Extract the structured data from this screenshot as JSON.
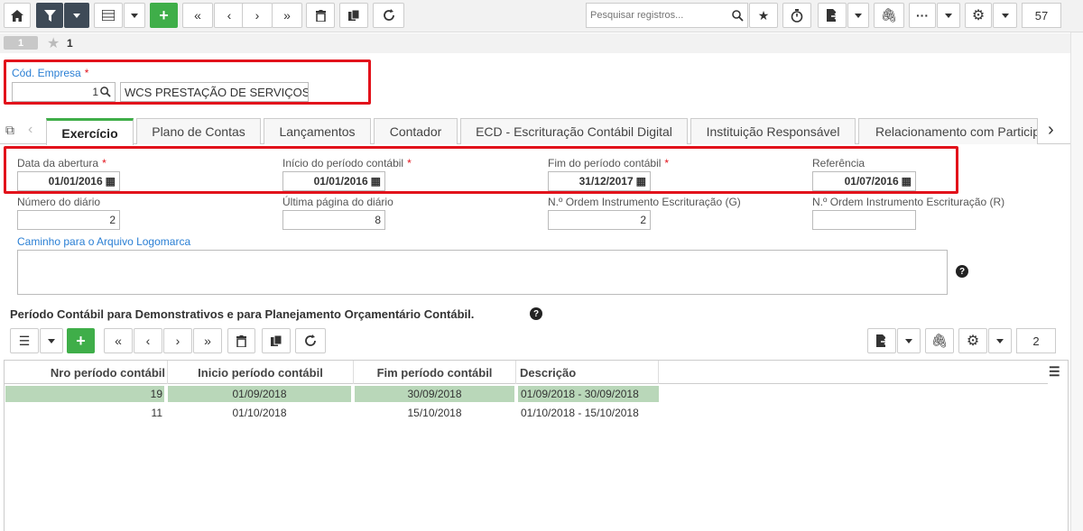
{
  "toolbar": {
    "home": "home-icon",
    "filter": "filter-icon",
    "list": "list-icon",
    "add": "+",
    "search_placeholder": "Pesquisar registros...",
    "record_count": "57"
  },
  "record_bar": {
    "record_number": "1",
    "favorites_count": "1"
  },
  "company": {
    "label": "Cód. Empresa",
    "required_mark": "*",
    "code_value": "1",
    "name_value": "WCS PRESTAÇÃO DE SERVIÇOS"
  },
  "tabs": [
    {
      "label": "Exercício"
    },
    {
      "label": "Plano de Contas"
    },
    {
      "label": "Lançamentos"
    },
    {
      "label": "Contador"
    },
    {
      "label": "ECD - Escrituração Contábil Digital"
    },
    {
      "label": "Instituição Responsável"
    },
    {
      "label": "Relacionamento com Particip"
    }
  ],
  "form": {
    "data_abertura": {
      "label": "Data da abertura",
      "value": "01/01/2016"
    },
    "inicio_periodo": {
      "label": "Início do período contábil",
      "value": "01/01/2016"
    },
    "fim_periodo": {
      "label": "Fim do período contábil",
      "value": "31/12/2017"
    },
    "referencia": {
      "label": "Referência",
      "value": "01/07/2016"
    },
    "numero_diario": {
      "label": "Número do diário",
      "value": "2"
    },
    "ultima_pagina": {
      "label": "Última página do diário",
      "value": "8"
    },
    "ordem_g": {
      "label": "N.º Ordem Instrumento Escrituração (G)",
      "value": "2"
    },
    "ordem_r": {
      "label": "N.º Ordem Instrumento Escrituração (R)",
      "value": ""
    },
    "logomarca": {
      "label": "Caminho para o Arquivo Logomarca",
      "value": ""
    },
    "required_mark": "*"
  },
  "section": {
    "title": "Período Contábil para Demonstrativos e para Planejamento Orçamentário Contábil.",
    "help": "?"
  },
  "sub_toolbar": {
    "add": "+",
    "record_count": "2"
  },
  "grid": {
    "columns": [
      "Nro período contábil",
      "Inicio período contábil",
      "Fim período contábil",
      "Descrição"
    ],
    "rows": [
      [
        "19",
        "01/09/2018",
        "30/09/2018",
        "01/09/2018 - 30/09/2018"
      ],
      [
        "11",
        "01/10/2018",
        "15/10/2018",
        "01/10/2018 - 15/10/2018"
      ]
    ]
  },
  "colors": {
    "highlight_red": "#e2121b",
    "accent_green": "#3fae49",
    "selected_row": "#b9d7b9",
    "dark_button": "#3e4a57",
    "link_blue": "#2a7fd4"
  }
}
